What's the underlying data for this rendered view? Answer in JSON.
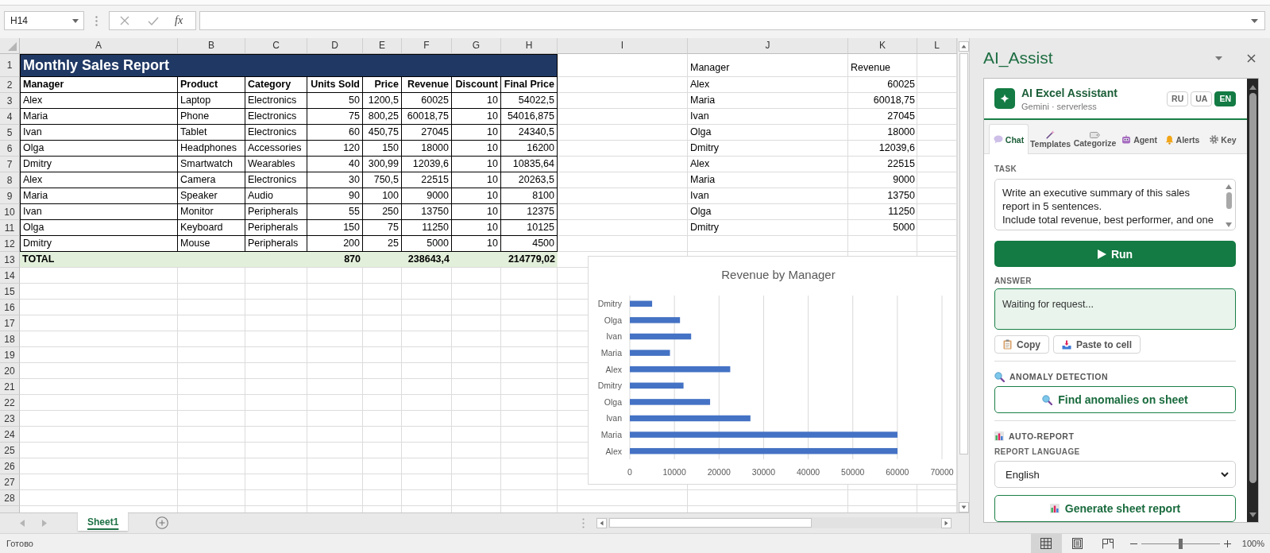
{
  "formula_bar": {
    "name_box": "H14",
    "function_button": "fx"
  },
  "sheet": {
    "column_headers": [
      "A",
      "B",
      "C",
      "D",
      "E",
      "F",
      "G",
      "H",
      "I",
      "J",
      "K",
      "L"
    ],
    "row_headers": [
      "1",
      "2",
      "3",
      "4",
      "5",
      "6",
      "7",
      "8",
      "9",
      "10",
      "11",
      "12",
      "13",
      "14",
      "15",
      "16",
      "17",
      "18",
      "19",
      "20",
      "21",
      "22",
      "23",
      "24",
      "25",
      "26",
      "27",
      "28"
    ],
    "report": {
      "title": "Monthly Sales Report",
      "header": [
        "Manager",
        "Product",
        "Category",
        "Units Sold",
        "Price",
        "Revenue",
        "Discount",
        "Final Price"
      ],
      "rows": [
        [
          "Alex",
          "Laptop",
          "Electronics",
          "50",
          "1200,5",
          "60025",
          "10",
          "54022,5"
        ],
        [
          "Maria",
          "Phone",
          "Electronics",
          "75",
          "800,25",
          "60018,75",
          "10",
          "54016,875"
        ],
        [
          "Ivan",
          "Tablet",
          "Electronics",
          "60",
          "450,75",
          "27045",
          "10",
          "24340,5"
        ],
        [
          "Olga",
          "Headphones",
          "Accessories",
          "120",
          "150",
          "18000",
          "10",
          "16200"
        ],
        [
          "Dmitry",
          "Smartwatch",
          "Wearables",
          "40",
          "300,99",
          "12039,6",
          "10",
          "10835,64"
        ],
        [
          "Alex",
          "Camera",
          "Electronics",
          "30",
          "750,5",
          "22515",
          "10",
          "20263,5"
        ],
        [
          "Maria",
          "Speaker",
          "Audio",
          "90",
          "100",
          "9000",
          "10",
          "8100"
        ],
        [
          "Ivan",
          "Monitor",
          "Peripherals",
          "55",
          "250",
          "13750",
          "10",
          "12375"
        ],
        [
          "Olga",
          "Keyboard",
          "Peripherals",
          "150",
          "75",
          "11250",
          "10",
          "10125"
        ],
        [
          "Dmitry",
          "Mouse",
          "Peripherals",
          "200",
          "25",
          "5000",
          "10",
          "4500"
        ]
      ],
      "total": {
        "label": "TOTAL",
        "units_sold": "870",
        "revenue": "238643,4",
        "final_price": "214779,02"
      }
    },
    "summary": {
      "header": [
        "Manager",
        "Revenue"
      ],
      "rows": [
        [
          "Alex",
          "60025"
        ],
        [
          "Maria",
          "60018,75"
        ],
        [
          "Ivan",
          "27045"
        ],
        [
          "Olga",
          "18000"
        ],
        [
          "Dmitry",
          "12039,6"
        ],
        [
          "Alex",
          "22515"
        ],
        [
          "Maria",
          "9000"
        ],
        [
          "Ivan",
          "13750"
        ],
        [
          "Olga",
          "11250"
        ],
        [
          "Dmitry",
          "5000"
        ]
      ]
    },
    "chart_data": {
      "type": "bar",
      "orientation": "horizontal",
      "title": "Revenue by Manager",
      "categories": [
        "Dmitry",
        "Olga",
        "Ivan",
        "Maria",
        "Alex",
        "Dmitry",
        "Olga",
        "Ivan",
        "Maria",
        "Alex"
      ],
      "series": [
        {
          "color": "#4472c4",
          "values": [
            5000,
            11250,
            13750,
            9000,
            22515,
            12039.6,
            18000,
            27045,
            60018.75,
            60025
          ]
        }
      ],
      "xlim": [
        0,
        70000
      ],
      "xticks": [
        0,
        10000,
        20000,
        30000,
        40000,
        50000,
        60000,
        70000
      ],
      "grid": true
    }
  },
  "sheet_tabs": [
    {
      "label": "Sheet1",
      "selected": true
    }
  ],
  "task_pane": {
    "title": "AI_Assist",
    "app_name": "AI Excel Assistant",
    "subtitle": "Gemini · serverless",
    "languages": [
      {
        "label": "RU",
        "selected": false
      },
      {
        "label": "UA",
        "selected": false
      },
      {
        "label": "EN",
        "selected": true
      }
    ],
    "tabs": [
      {
        "label": "Chat",
        "selected": true
      },
      {
        "label": "Templates",
        "selected": false
      },
      {
        "label": "Categorize",
        "selected": false
      },
      {
        "label": "Agent",
        "selected": false
      },
      {
        "label": "Alerts",
        "selected": false
      },
      {
        "label": "Key",
        "selected": false
      }
    ],
    "task": {
      "label": "TASK",
      "value": "Write an executive summary of this sales report in 5 sentences.\nInclude total revenue, best performer, and one"
    },
    "run_button": "Run",
    "answer": {
      "label": "ANSWER",
      "text": "Waiting for request..."
    },
    "answer_actions": [
      "Copy",
      "Paste to cell"
    ],
    "anomaly": {
      "heading": "ANOMALY DETECTION",
      "button": "Find anomalies on sheet"
    },
    "auto_report": {
      "heading": "AUTO-REPORT",
      "language_label": "REPORT LANGUAGE",
      "language": "English",
      "button": "Generate sheet report"
    }
  },
  "status_bar": {
    "text": "Готово",
    "views": [
      {
        "kind": "normal",
        "selected": true
      },
      {
        "kind": "page_layout",
        "selected": false
      },
      {
        "kind": "page_break",
        "selected": false
      }
    ],
    "zoom": {
      "level": 0.5,
      "label": "100%"
    }
  }
}
